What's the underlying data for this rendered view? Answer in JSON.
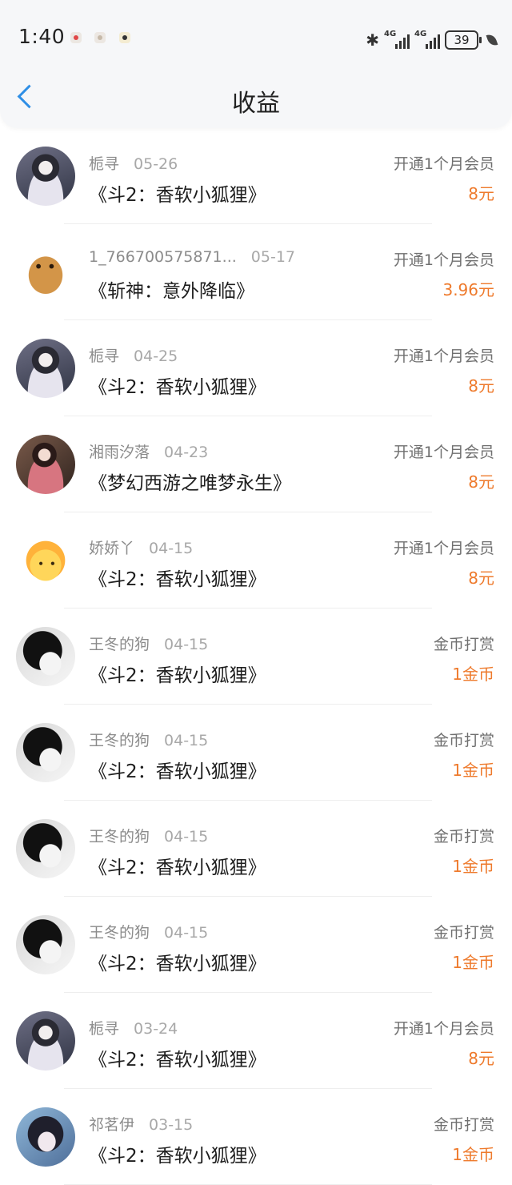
{
  "status_bar": {
    "time": "1:40",
    "battery": "39",
    "net1": "4G",
    "net2": "4G"
  },
  "header": {
    "title": "收益"
  },
  "colors": {
    "accent_blue": "#2f8fe6",
    "amount_orange": "#ee7a2c"
  },
  "icons": {
    "back": "chevron-left-icon"
  },
  "items": [
    {
      "user": "栀寻",
      "date": "05-26",
      "book": "《斗2：香软小狐狸》",
      "type": "开通1个月会员",
      "amount": "8元",
      "avatar": "girl-dark"
    },
    {
      "user": "1_766700575871...",
      "date": "05-17",
      "book": "《斩神：意外降临》",
      "type": "开通1个月会员",
      "amount": "3.96元",
      "avatar": "dog"
    },
    {
      "user": "栀寻",
      "date": "04-25",
      "book": "《斗2：香软小狐狸》",
      "type": "开通1个月会员",
      "amount": "8元",
      "avatar": "girl-dark"
    },
    {
      "user": "湘雨汐落",
      "date": "04-23",
      "book": "《梦幻西游之唯梦永生》",
      "type": "开通1个月会员",
      "amount": "8元",
      "avatar": "girl-book"
    },
    {
      "user": "娇娇丫",
      "date": "04-15",
      "book": "《斗2：香软小狐狸》",
      "type": "开通1个月会员",
      "amount": "8元",
      "avatar": "chick"
    },
    {
      "user": "王冬的狗",
      "date": "04-15",
      "book": "《斗2：香软小狐狸》",
      "type": "金币打赏",
      "amount": "1金币",
      "avatar": "anime-boy"
    },
    {
      "user": "王冬的狗",
      "date": "04-15",
      "book": "《斗2：香软小狐狸》",
      "type": "金币打赏",
      "amount": "1金币",
      "avatar": "anime-boy"
    },
    {
      "user": "王冬的狗",
      "date": "04-15",
      "book": "《斗2：香软小狐狸》",
      "type": "金币打赏",
      "amount": "1金币",
      "avatar": "anime-boy"
    },
    {
      "user": "王冬的狗",
      "date": "04-15",
      "book": "《斗2：香软小狐狸》",
      "type": "金币打赏",
      "amount": "1金币",
      "avatar": "anime-boy"
    },
    {
      "user": "栀寻",
      "date": "03-24",
      "book": "《斗2：香软小狐狸》",
      "type": "开通1个月会员",
      "amount": "8元",
      "avatar": "girl-dark"
    },
    {
      "user": "祁茗伊",
      "date": "03-15",
      "book": "《斗2：香软小狐狸》",
      "type": "金币打赏",
      "amount": "1金币",
      "avatar": "anime-girl"
    }
  ]
}
